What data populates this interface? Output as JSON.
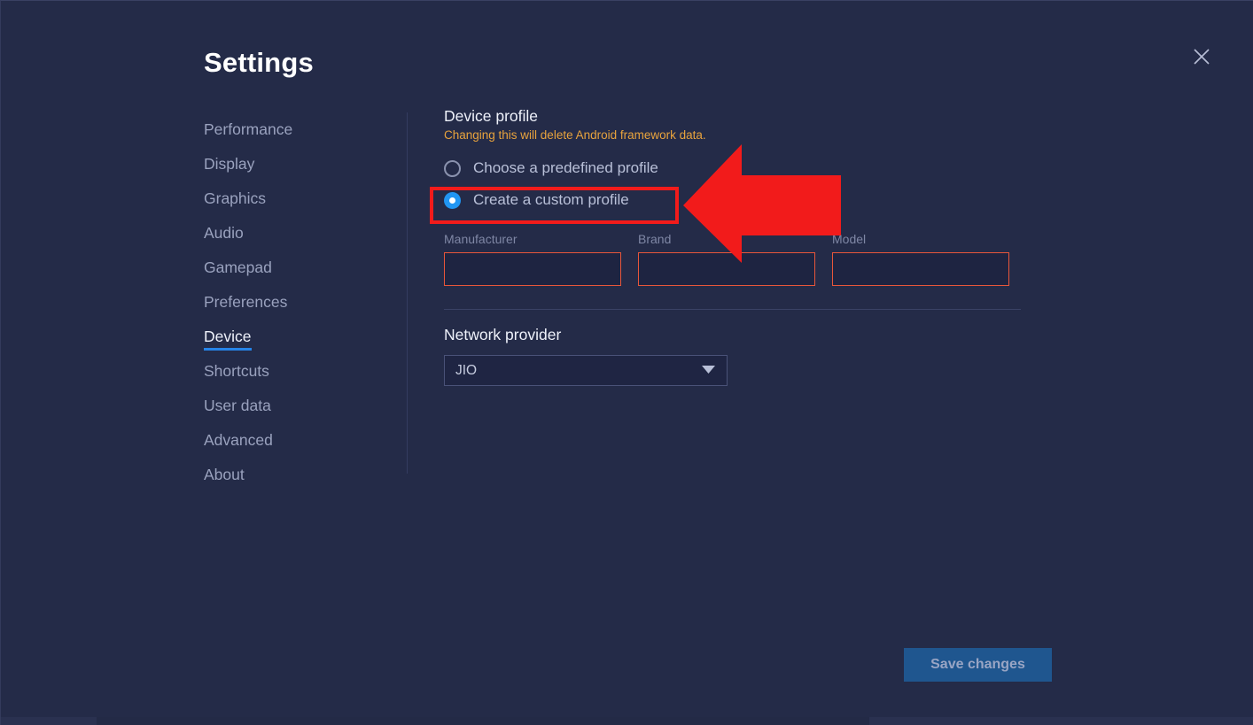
{
  "window": {
    "title": "Settings",
    "close_icon": "close-icon"
  },
  "sidebar": {
    "items": [
      {
        "label": "Performance",
        "active": false
      },
      {
        "label": "Display",
        "active": false
      },
      {
        "label": "Graphics",
        "active": false
      },
      {
        "label": "Audio",
        "active": false
      },
      {
        "label": "Gamepad",
        "active": false
      },
      {
        "label": "Preferences",
        "active": false
      },
      {
        "label": "Device",
        "active": true
      },
      {
        "label": "Shortcuts",
        "active": false
      },
      {
        "label": "User data",
        "active": false
      },
      {
        "label": "Advanced",
        "active": false
      },
      {
        "label": "About",
        "active": false
      }
    ]
  },
  "main": {
    "device_profile": {
      "title": "Device profile",
      "warning": "Changing this will delete Android framework data.",
      "options": [
        {
          "label": "Choose a predefined profile",
          "selected": false
        },
        {
          "label": "Create a custom profile",
          "selected": true
        }
      ]
    },
    "custom_fields": [
      {
        "label": "Manufacturer",
        "value": "",
        "placeholder": ""
      },
      {
        "label": "Brand",
        "value": "",
        "placeholder": ""
      },
      {
        "label": "Model",
        "value": "",
        "placeholder": ""
      }
    ],
    "network_provider": {
      "label": "Network provider",
      "selected": "JIO",
      "chevron_icon": "chevron-down-icon"
    }
  },
  "footer": {
    "save_label": "Save changes"
  },
  "annotations": {
    "arrow": {
      "icon": "left-arrow-annotation",
      "color": "#f21b1b"
    },
    "highlight_box": {
      "color": "#f21b1b",
      "target": "Create a custom profile"
    }
  },
  "colors": {
    "background": "#242b48",
    "accent_blue": "#2684e8",
    "radio_selected": "#2196f3",
    "warning_amber": "#e8a33d",
    "input_border_error": "#e8563a",
    "save_button": "#1f568f",
    "annotation_red": "#f21b1b"
  }
}
